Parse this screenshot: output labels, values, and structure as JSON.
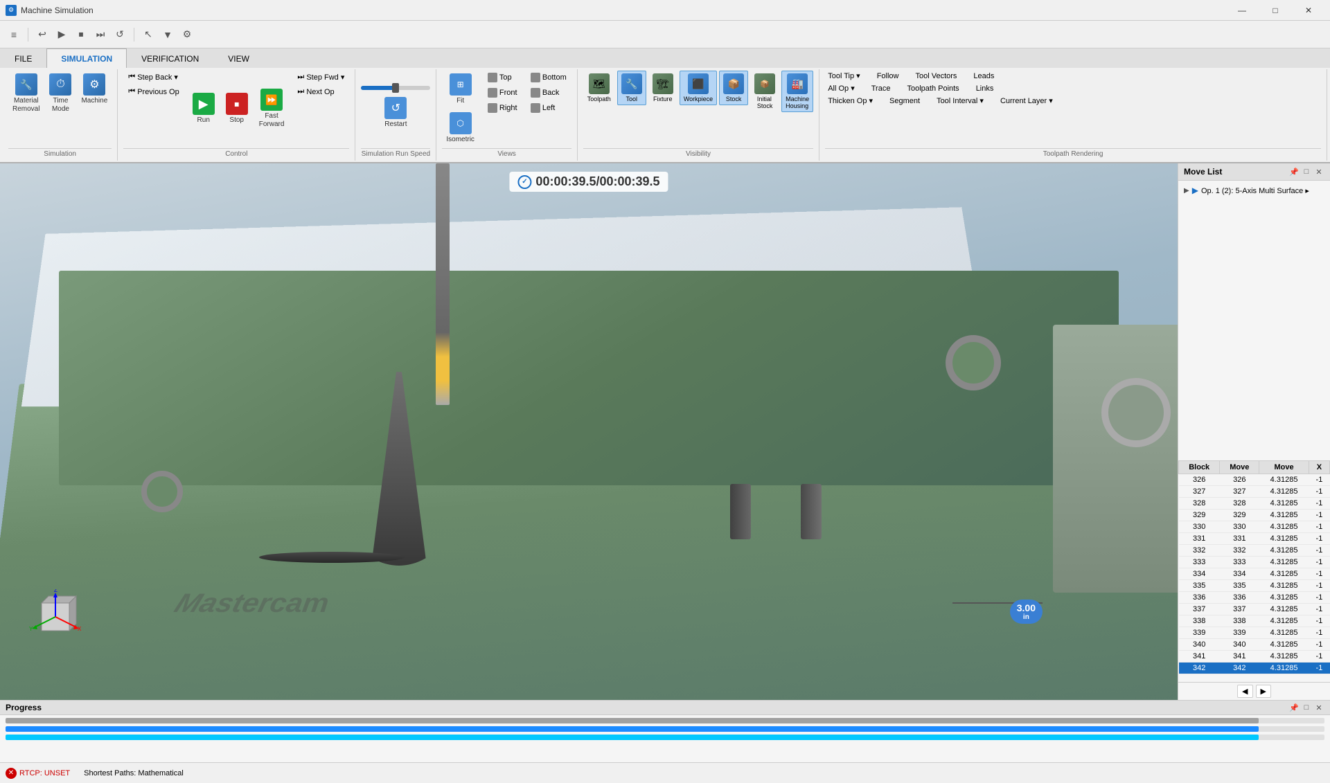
{
  "titleBar": {
    "icon": "⚙",
    "title": "Machine Simulation",
    "minimize": "—",
    "restore": "□",
    "close": "✕"
  },
  "quickAccess": {
    "buttons": [
      "≡",
      "↩",
      "▶",
      "⏹",
      "⏭",
      "↺"
    ]
  },
  "ribbon": {
    "tabs": [
      "FILE",
      "SIMULATION",
      "VERIFICATION",
      "VIEW"
    ],
    "activeTab": "SIMULATION",
    "groups": {
      "simulation": {
        "label": "Simulation",
        "buttons": [
          {
            "id": "material-removal",
            "label": "Material\nRemoval",
            "icon": "🔧"
          },
          {
            "id": "time-mode",
            "label": "Time\nMode",
            "icon": "⏱"
          },
          {
            "id": "machine",
            "label": "Machine",
            "icon": "⚙"
          }
        ]
      },
      "control": {
        "label": "Control",
        "stepBack": "Step Back ▾",
        "prevOp": "Previous Op",
        "run": "Run",
        "stop": "Stop",
        "fastForward": "Fast\nForward",
        "stepFwd": "Step Fwd ▾",
        "nextOp": "Next Op"
      },
      "speed": {
        "label": "Simulation Run Speed",
        "restartLabel": "Restart"
      },
      "views": {
        "label": "Views",
        "fit": "Fit",
        "isometric": "Isometric",
        "top": "Top",
        "bottom": "Bottom",
        "front": "Front",
        "back": "Back",
        "right": "Right",
        "left": "Left"
      },
      "visibility": {
        "label": "Visibility",
        "toolpath": "Toolpath",
        "tool": "Tool",
        "fixture": "Fixture",
        "workpiece": "Workpiece",
        "stock": "Stock",
        "initialStock": "Initial\nStock",
        "machineHousing": "Machine\nHousing"
      },
      "toolpathRendering": {
        "label": "Toolpath Rendering",
        "toolTip": "Tool Tip ▾",
        "allOp": "All Op ▾",
        "trace": "Trace",
        "toolpathPoints": "Toolpath Points",
        "links": "Links",
        "follow": "Follow",
        "toolVectors": "Tool Vectors",
        "leads": "Leads",
        "thickenOp": "Thicken Op ▾",
        "segment": "Segment",
        "toolInterval": "Tool Interval ▾",
        "currentLayer": "Current Layer ▾"
      }
    }
  },
  "viewport": {
    "timer": "00:00:39.5/00:00:39.5",
    "dimension": {
      "value": "3.00",
      "unit": "in"
    }
  },
  "moveList": {
    "title": "Move List",
    "opLabel": "Op. 1 (2): 5-Axis Multi Surface ▸",
    "columns": [
      "Block",
      "Move",
      "Move",
      "X"
    ],
    "rows": [
      {
        "block": 326,
        "move1": 326,
        "move2": "4.31285",
        "x": "-1"
      },
      {
        "block": 327,
        "move1": 327,
        "move2": "4.31285",
        "x": "-1"
      },
      {
        "block": 328,
        "move1": 328,
        "move2": "4.31285",
        "x": "-1"
      },
      {
        "block": 329,
        "move1": 329,
        "move2": "4.31285",
        "x": "-1"
      },
      {
        "block": 330,
        "move1": 330,
        "move2": "4.31285",
        "x": "-1"
      },
      {
        "block": 331,
        "move1": 331,
        "move2": "4.31285",
        "x": "-1"
      },
      {
        "block": 332,
        "move1": 332,
        "move2": "4.31285",
        "x": "-1"
      },
      {
        "block": 333,
        "move1": 333,
        "move2": "4.31285",
        "x": "-1"
      },
      {
        "block": 334,
        "move1": 334,
        "move2": "4.31285",
        "x": "-1"
      },
      {
        "block": 335,
        "move1": 335,
        "move2": "4.31285",
        "x": "-1"
      },
      {
        "block": 336,
        "move1": 336,
        "move2": "4.31285",
        "x": "-1"
      },
      {
        "block": 337,
        "move1": 337,
        "move2": "4.31285",
        "x": "-1"
      },
      {
        "block": 338,
        "move1": 338,
        "move2": "4.31285",
        "x": "-1"
      },
      {
        "block": 339,
        "move1": 339,
        "move2": "4.31285",
        "x": "-1"
      },
      {
        "block": 340,
        "move1": 340,
        "move2": "4.31285",
        "x": "-1"
      },
      {
        "block": 341,
        "move1": 341,
        "move2": "4.31285",
        "x": "-1"
      },
      {
        "block": 342,
        "move1": 342,
        "move2": "4.31285",
        "x": "-1"
      }
    ],
    "selectedRow": 342
  },
  "progress": {
    "title": "Progress",
    "bars": [
      {
        "color": "gray",
        "width": "95%"
      },
      {
        "color": "blue",
        "width": "95%"
      },
      {
        "color": "cyan",
        "width": "95%"
      }
    ]
  },
  "statusBar": {
    "errorIcon": "✕",
    "errorText": "RTCP: UNSET",
    "infoText": "Shortest Paths: Mathematical"
  }
}
